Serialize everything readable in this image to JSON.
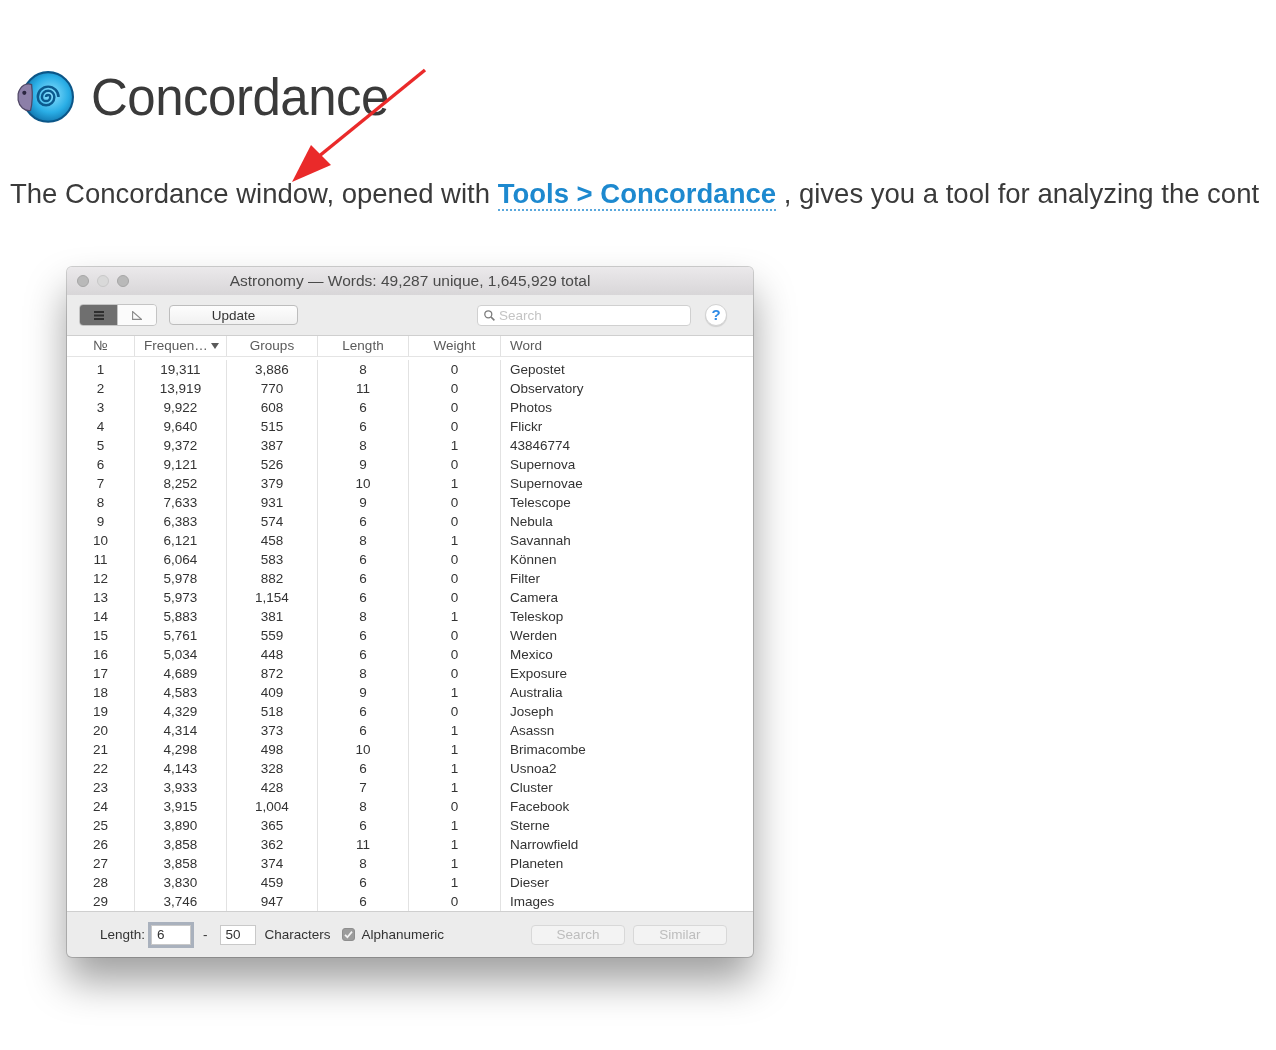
{
  "header": {
    "title": "Concordance"
  },
  "intro": {
    "before": "The Concordance window, opened with ",
    "link": "Tools > Concordance",
    "after": " , gives you a tool for analyzing the cont"
  },
  "window": {
    "title": "Astronomy — Words: 49,287 unique, 1,645,929 total"
  },
  "toolbar": {
    "view_toggle": [
      {
        "selected": true
      },
      {
        "selected": false
      }
    ],
    "update_button": "Update",
    "search": {
      "placeholder": "Search"
    },
    "help_button": "?"
  },
  "table": {
    "columns": [
      {
        "label": "№",
        "sorted": false
      },
      {
        "label": "Frequen…",
        "sorted": true
      },
      {
        "label": "Groups",
        "sorted": false
      },
      {
        "label": "Length",
        "sorted": false
      },
      {
        "label": "Weight",
        "sorted": false
      },
      {
        "label": "Word",
        "sorted": false
      }
    ],
    "rows": [
      [
        "1",
        "19,311",
        "3,886",
        "8",
        "0",
        "Gepostet"
      ],
      [
        "2",
        "13,919",
        "770",
        "11",
        "0",
        "Observatory"
      ],
      [
        "3",
        "9,922",
        "608",
        "6",
        "0",
        "Photos"
      ],
      [
        "4",
        "9,640",
        "515",
        "6",
        "0",
        "Flickr"
      ],
      [
        "5",
        "9,372",
        "387",
        "8",
        "1",
        "43846774"
      ],
      [
        "6",
        "9,121",
        "526",
        "9",
        "0",
        "Supernova"
      ],
      [
        "7",
        "8,252",
        "379",
        "10",
        "1",
        "Supernovae"
      ],
      [
        "8",
        "7,633",
        "931",
        "9",
        "0",
        "Telescope"
      ],
      [
        "9",
        "6,383",
        "574",
        "6",
        "0",
        "Nebula"
      ],
      [
        "10",
        "6,121",
        "458",
        "8",
        "1",
        "Savannah"
      ],
      [
        "11",
        "6,064",
        "583",
        "6",
        "0",
        "Können"
      ],
      [
        "12",
        "5,978",
        "882",
        "6",
        "0",
        "Filter"
      ],
      [
        "13",
        "5,973",
        "1,154",
        "6",
        "0",
        "Camera"
      ],
      [
        "14",
        "5,883",
        "381",
        "8",
        "1",
        "Teleskop"
      ],
      [
        "15",
        "5,761",
        "559",
        "6",
        "0",
        "Werden"
      ],
      [
        "16",
        "5,034",
        "448",
        "6",
        "0",
        "Mexico"
      ],
      [
        "17",
        "4,689",
        "872",
        "8",
        "0",
        "Exposure"
      ],
      [
        "18",
        "4,583",
        "409",
        "9",
        "1",
        "Australia"
      ],
      [
        "19",
        "4,329",
        "518",
        "6",
        "0",
        "Joseph"
      ],
      [
        "20",
        "4,314",
        "373",
        "6",
        "1",
        "Asassn"
      ],
      [
        "21",
        "4,298",
        "498",
        "10",
        "1",
        "Brimacombe"
      ],
      [
        "22",
        "4,143",
        "328",
        "6",
        "1",
        "Usnoa2"
      ],
      [
        "23",
        "3,933",
        "428",
        "7",
        "1",
        "Cluster"
      ],
      [
        "24",
        "3,915",
        "1,004",
        "8",
        "0",
        "Facebook"
      ],
      [
        "25",
        "3,890",
        "365",
        "6",
        "1",
        "Sterne"
      ],
      [
        "26",
        "3,858",
        "362",
        "11",
        "1",
        "Narrowfield"
      ],
      [
        "27",
        "3,858",
        "374",
        "8",
        "1",
        "Planeten"
      ],
      [
        "28",
        "3,830",
        "459",
        "6",
        "1",
        "Dieser"
      ],
      [
        "29",
        "3,746",
        "947",
        "6",
        "0",
        "Images"
      ]
    ]
  },
  "footer": {
    "length_label": "Length:",
    "min_field": {
      "value": "6",
      "focused": true
    },
    "dash": "-",
    "max_field": {
      "value": "50",
      "focused": false
    },
    "characters_label": "Characters",
    "alphanumeric": {
      "label": "Alphanumeric",
      "checked": true
    },
    "buttons": [
      {
        "label": "Search",
        "disabled": true
      },
      {
        "label": "Similar",
        "disabled": true
      }
    ]
  }
}
